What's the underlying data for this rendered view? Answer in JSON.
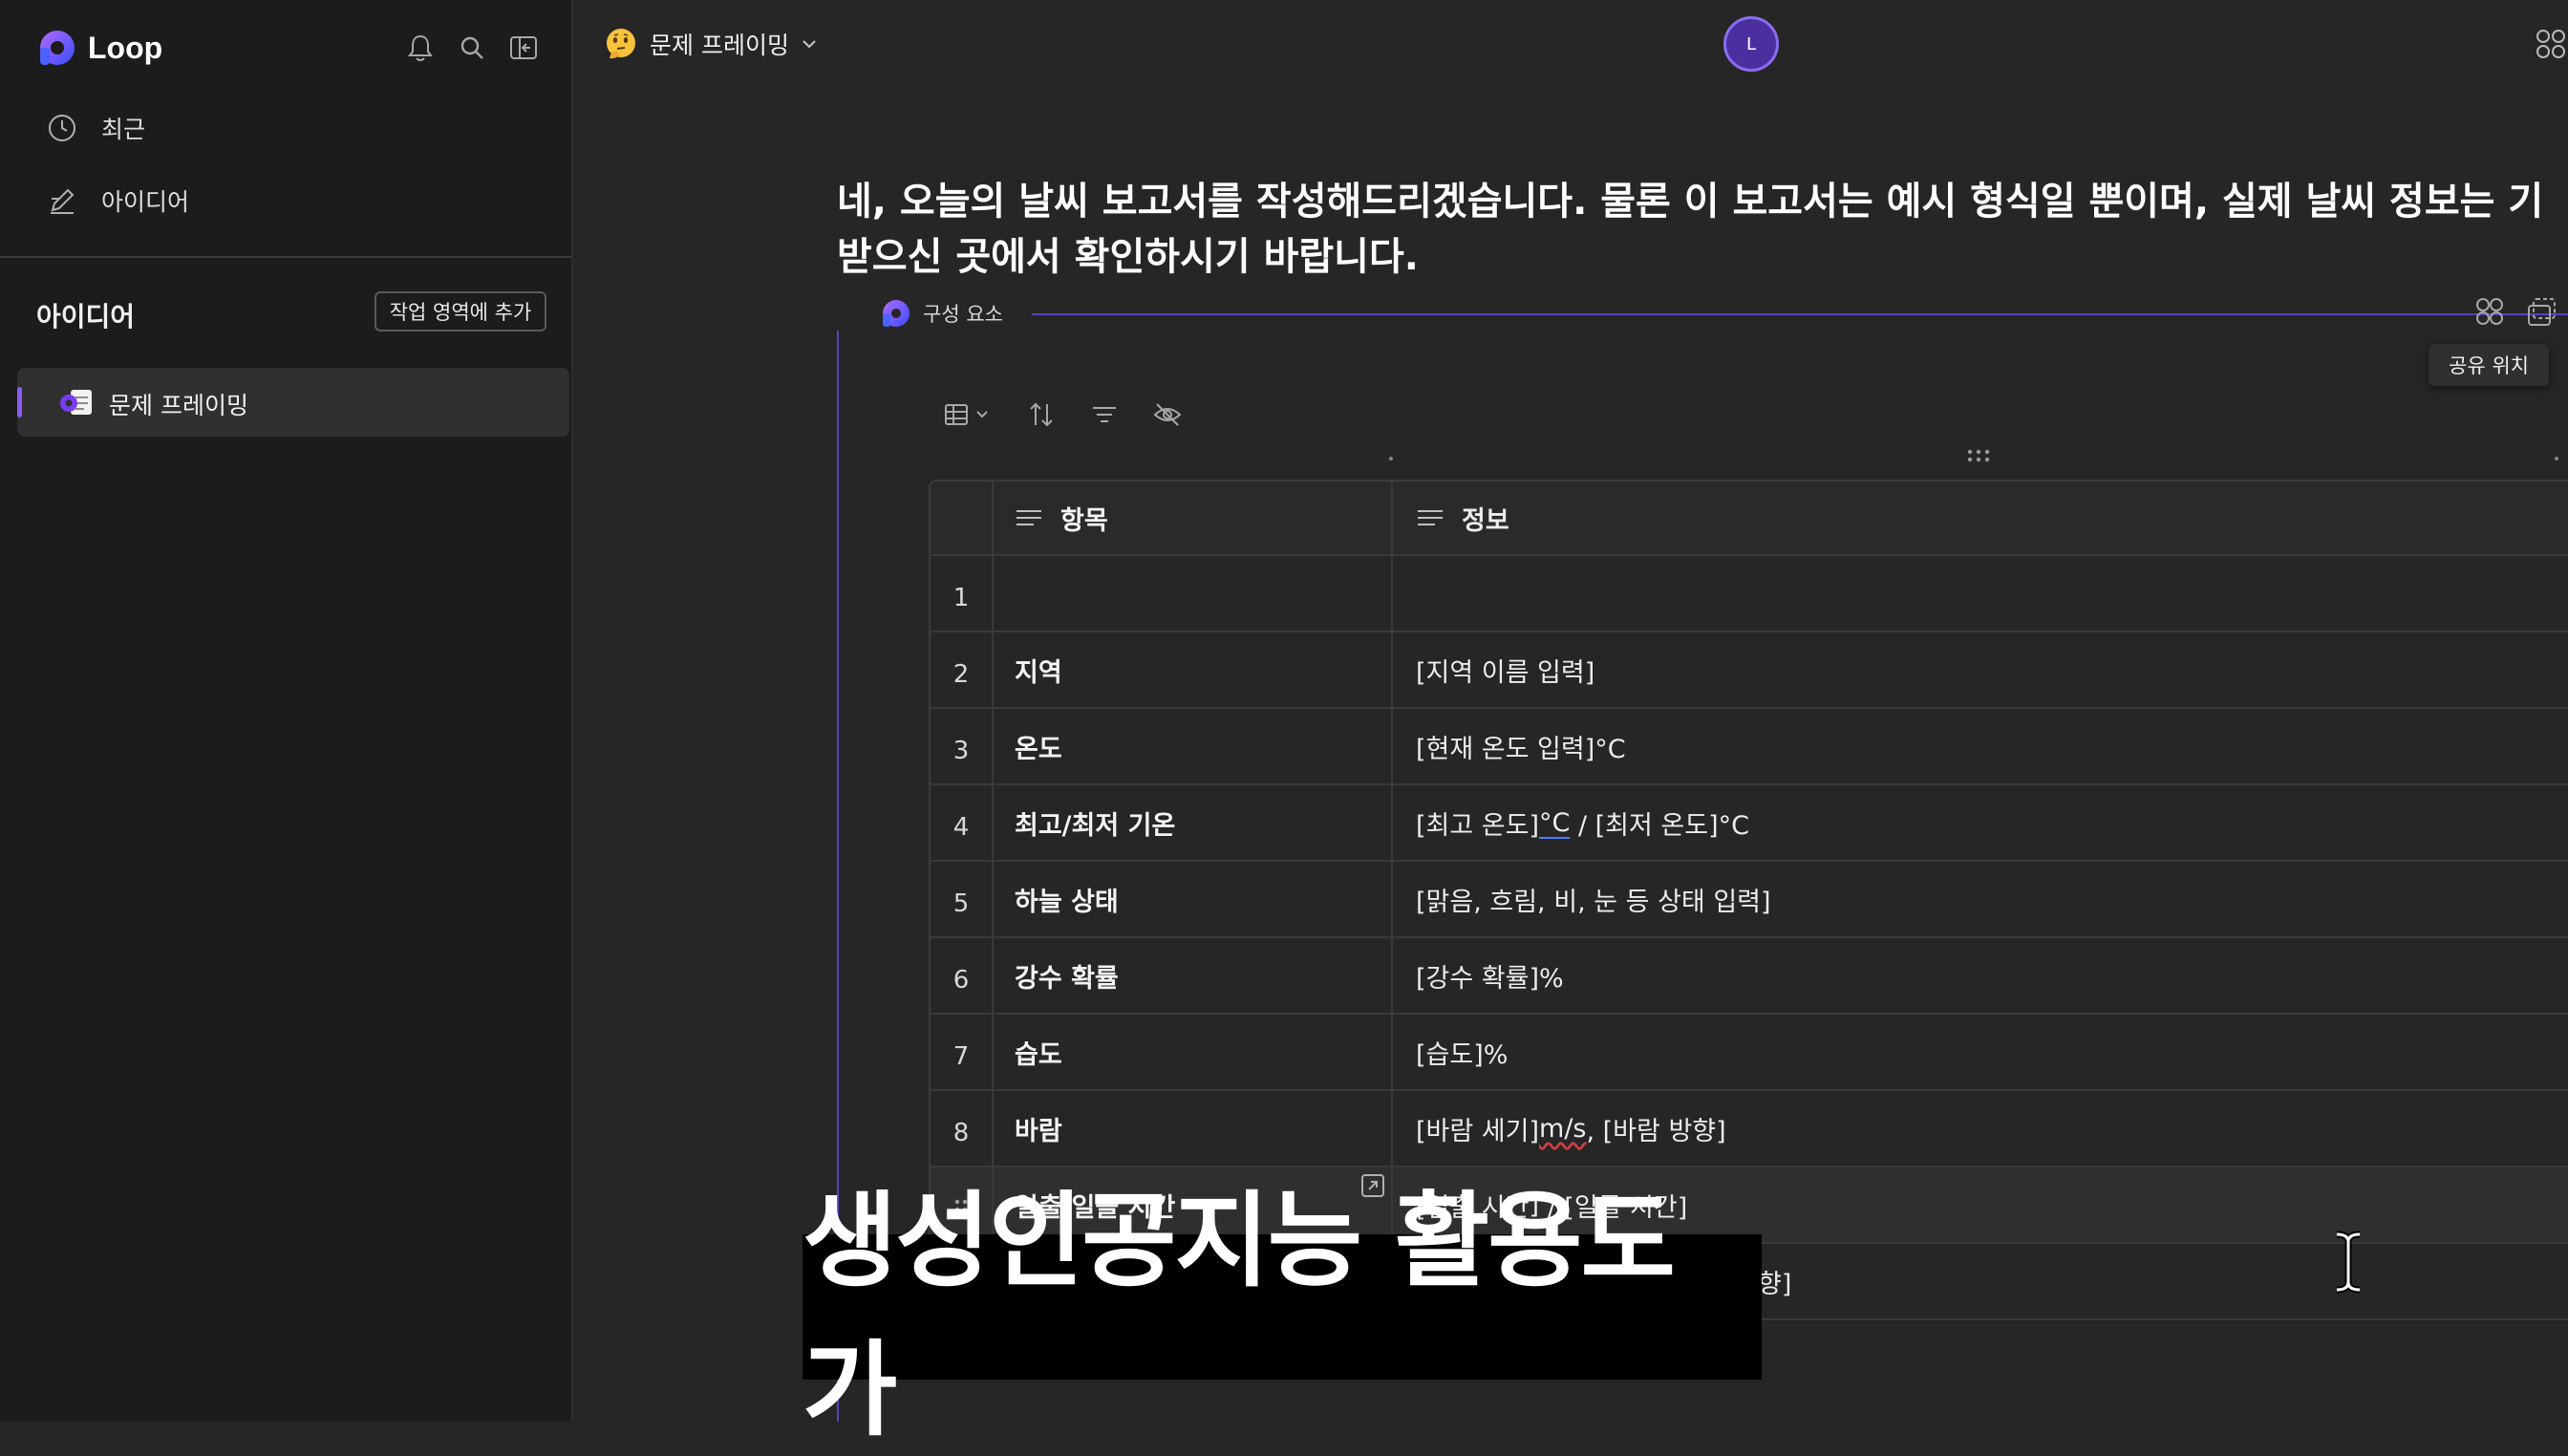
{
  "app": {
    "name": "Loop"
  },
  "sidebar": {
    "nav": [
      {
        "label": "최근",
        "icon": "clock-icon"
      },
      {
        "label": "아이디어",
        "icon": "pen-icon"
      }
    ],
    "section_title": "아이디어",
    "add_button": "작업 영역에 추가",
    "pages": [
      {
        "label": "문제 프레이밍",
        "active": true
      }
    ]
  },
  "header": {
    "breadcrumb": "문제 프레이밍",
    "avatar_initial": "L"
  },
  "content": {
    "heading_line1": "네, 오늘의 날씨 보고서를 작성해드리겠습니다. 물론 이 보고서는 예시 형식일 뿐이며, 실제 날씨 정보는 기",
    "heading_line2": "받으신 곳에서 확인하시기 바랍니다.",
    "component_label": "구성 요소",
    "tooltip": "공유 위치"
  },
  "table": {
    "columns": [
      "항목",
      "정보"
    ],
    "rows": [
      {
        "num": "1",
        "item": "",
        "info": ""
      },
      {
        "num": "2",
        "item": "지역",
        "info": "[지역 이름 입력]"
      },
      {
        "num": "3",
        "item": "온도",
        "info": "[현재 온도 입력]°C"
      },
      {
        "num": "4",
        "item": "최고/최저 기온",
        "info_a": "[최고 온도]",
        "info_b": "°C",
        "info_c": " / [최저 온도]°C"
      },
      {
        "num": "5",
        "item": "하늘 상태",
        "info": "[맑음, 흐림, 비, 눈 등 상태 입력]"
      },
      {
        "num": "6",
        "item": "강수 확률",
        "info": "[강수 확률]%"
      },
      {
        "num": "7",
        "item": "습도",
        "info": "[습도]%"
      },
      {
        "num": "8",
        "item": "바람",
        "info_a": "[바람 세기]",
        "info_b": "m/s",
        "info_c": ", [바람 방향]"
      },
      {
        "num": "",
        "item": "일출/일몰 시간",
        "info_a": "[일출 시간",
        "info_b": "]",
        "info_c": " / [일몰 시간]"
      },
      {
        "num": "",
        "item": "",
        "info": "향]"
      }
    ]
  },
  "caption": "생성인공지능 활용도가",
  "colors": {
    "accent": "#8a5cf6",
    "background": "#262626",
    "sidebar": "#1c1c1c"
  }
}
